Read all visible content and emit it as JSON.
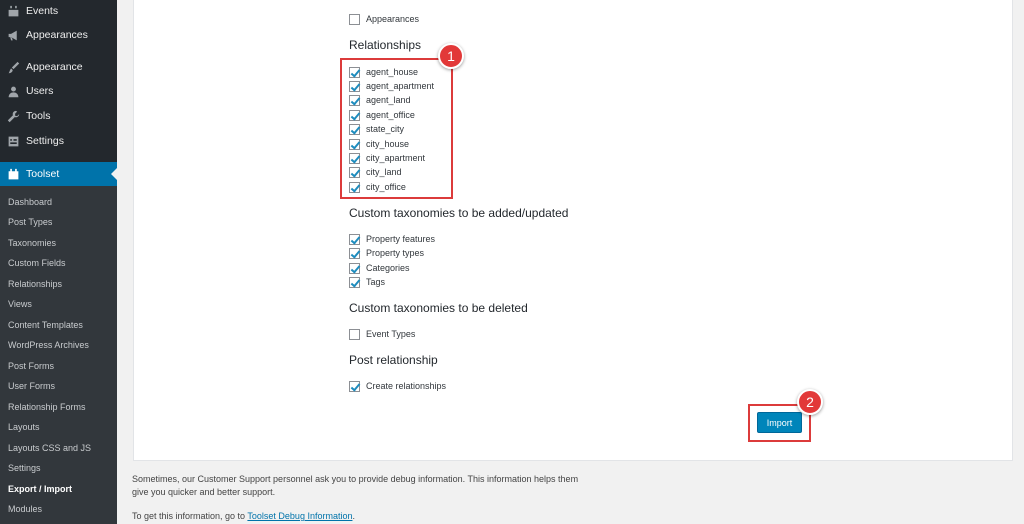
{
  "sidebar": {
    "top_items": [
      {
        "label": "Events",
        "icon": "calendar-icon"
      },
      {
        "label": "Appearances",
        "icon": "megaphone-icon"
      },
      {
        "label": "Appearance",
        "icon": "paintbrush-icon"
      },
      {
        "label": "Users",
        "icon": "user-icon"
      },
      {
        "label": "Tools",
        "icon": "wrench-icon"
      },
      {
        "label": "Settings",
        "icon": "settings-icon"
      }
    ],
    "toolset": {
      "label": "Toolset",
      "icon": "toolset-icon"
    },
    "sub_items": [
      "Dashboard",
      "Post Types",
      "Taxonomies",
      "Custom Fields",
      "Relationships",
      "Views",
      "Content Templates",
      "WordPress Archives",
      "Post Forms",
      "User Forms",
      "Relationship Forms",
      "Layouts",
      "Layouts CSS and JS",
      "Settings",
      "Export / Import",
      "Modules"
    ],
    "current_sub": "Export / Import"
  },
  "main": {
    "appearances": {
      "label": "Appearances",
      "checked": false
    },
    "relationships": {
      "heading": "Relationships",
      "items": [
        {
          "label": "agent_house",
          "checked": true
        },
        {
          "label": "agent_apartment",
          "checked": true
        },
        {
          "label": "agent_land",
          "checked": true
        },
        {
          "label": "agent_office",
          "checked": true
        },
        {
          "label": "state_city",
          "checked": true
        },
        {
          "label": "city_house",
          "checked": true
        },
        {
          "label": "city_apartment",
          "checked": true
        },
        {
          "label": "city_land",
          "checked": true
        },
        {
          "label": "city_office",
          "checked": true
        }
      ]
    },
    "taxonomies_added": {
      "heading": "Custom taxonomies to be added/updated",
      "items": [
        {
          "label": "Property features",
          "checked": true
        },
        {
          "label": "Property types",
          "checked": true
        },
        {
          "label": "Categories",
          "checked": true
        },
        {
          "label": "Tags",
          "checked": true
        }
      ]
    },
    "taxonomies_deleted": {
      "heading": "Custom taxonomies to be deleted",
      "items": [
        {
          "label": "Event Types",
          "checked": false
        }
      ]
    },
    "post_relationship": {
      "heading": "Post relationship",
      "items": [
        {
          "label": "Create relationships",
          "checked": true
        }
      ]
    },
    "import_label": "Import",
    "badge_1": "1",
    "badge_2": "2"
  },
  "footer": {
    "line1": "Sometimes, our Customer Support personnel ask you to provide debug information. This information helps them",
    "line2": "give you quicker and better support.",
    "line3_prefix": "To get this information, go to ",
    "link_text": "Toolset Debug Information",
    "line3_suffix": "."
  },
  "colors": {
    "sidebar_bg": "#23282d",
    "submenu_bg": "#32373c",
    "accent": "#0073aa",
    "highlight": "#dc3b3b"
  }
}
